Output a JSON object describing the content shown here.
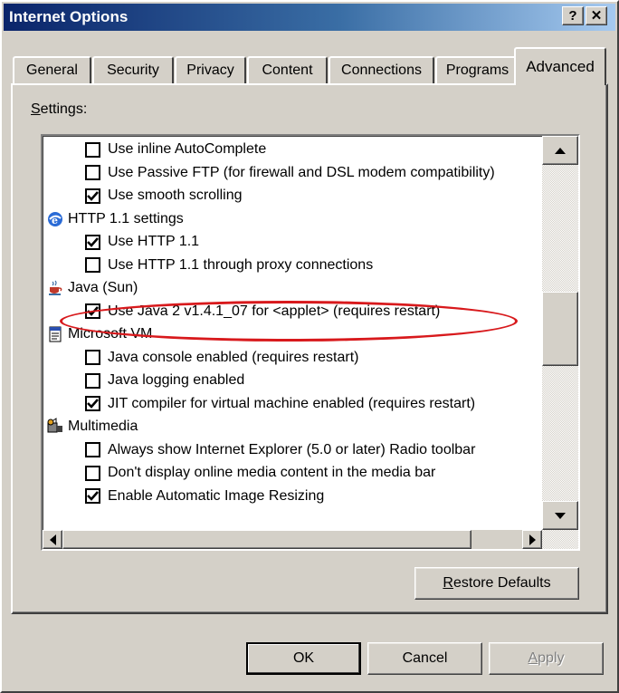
{
  "window": {
    "title": "Internet Options",
    "help_glyph": "?",
    "close_glyph": "✕"
  },
  "tabs": [
    {
      "label": "General"
    },
    {
      "label": "Security"
    },
    {
      "label": "Privacy"
    },
    {
      "label": "Content"
    },
    {
      "label": "Connections"
    },
    {
      "label": "Programs"
    },
    {
      "label": "Advanced",
      "active": true
    }
  ],
  "settings": {
    "label_mnemonic": "S",
    "label_rest": "ettings:",
    "items": [
      {
        "kind": "checkbox",
        "label": "Use inline AutoComplete",
        "checked": false
      },
      {
        "kind": "checkbox",
        "label": "Use Passive FTP (for firewall and DSL modem compatibility)",
        "checked": false
      },
      {
        "kind": "checkbox",
        "label": "Use smooth scrolling",
        "checked": true
      },
      {
        "kind": "category",
        "label": "HTTP 1.1 settings",
        "icon": "ie-globe-icon"
      },
      {
        "kind": "checkbox",
        "label": "Use HTTP 1.1",
        "checked": true
      },
      {
        "kind": "checkbox",
        "label": "Use HTTP 1.1 through proxy connections",
        "checked": false
      },
      {
        "kind": "category",
        "label": "Java (Sun)",
        "icon": "java-cup-icon"
      },
      {
        "kind": "checkbox",
        "label": "Use Java 2 v1.4.1_07 for <applet> (requires restart)",
        "checked": true
      },
      {
        "kind": "category",
        "label": "Microsoft VM",
        "icon": "document-icon"
      },
      {
        "kind": "checkbox",
        "label": "Java console enabled (requires restart)",
        "checked": false
      },
      {
        "kind": "checkbox",
        "label": "Java logging enabled",
        "checked": false
      },
      {
        "kind": "checkbox",
        "label": "JIT compiler for virtual machine enabled (requires restart)",
        "checked": true
      },
      {
        "kind": "category",
        "label": "Multimedia",
        "icon": "multimedia-icon"
      },
      {
        "kind": "checkbox",
        "label": "Always show Internet Explorer (5.0 or later) Radio toolbar",
        "checked": false
      },
      {
        "kind": "checkbox",
        "label": "Don't display online media content in the media bar",
        "checked": false
      },
      {
        "kind": "checkbox",
        "label": "Enable Automatic Image Resizing",
        "checked": true
      }
    ]
  },
  "buttons": {
    "restore_mnemonic": "R",
    "restore_rest": "estore Defaults",
    "ok": "OK",
    "cancel": "Cancel",
    "apply_mnemonic": "A",
    "apply_rest": "pply"
  },
  "colors": {
    "title_start": "#0a246a",
    "title_end": "#a6caf0",
    "face": "#d4d0c8",
    "annotation": "#d8191c"
  }
}
